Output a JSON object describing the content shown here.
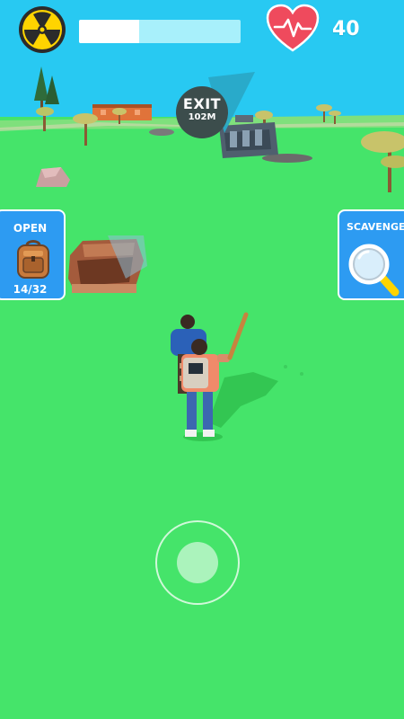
{
  "hud": {
    "radiation_icon": "radiation-icon",
    "radiation_level": 0.37,
    "health_icon": "heart-icon",
    "health": "40"
  },
  "exit_marker": {
    "title": "EXIT",
    "distance": "102M"
  },
  "open_panel": {
    "title": "OPEN",
    "icon": "backpack-icon",
    "count": "14/32"
  },
  "scavenge_panel": {
    "title": "SCAVENGE",
    "icon": "magnifier-icon"
  },
  "colors": {
    "sky": "#28c9f2",
    "grass": "#45e46a",
    "panel_blue": "#2d9bf2",
    "heart_red": "#ef4a5d",
    "radiation_yellow": "#ffd400"
  }
}
